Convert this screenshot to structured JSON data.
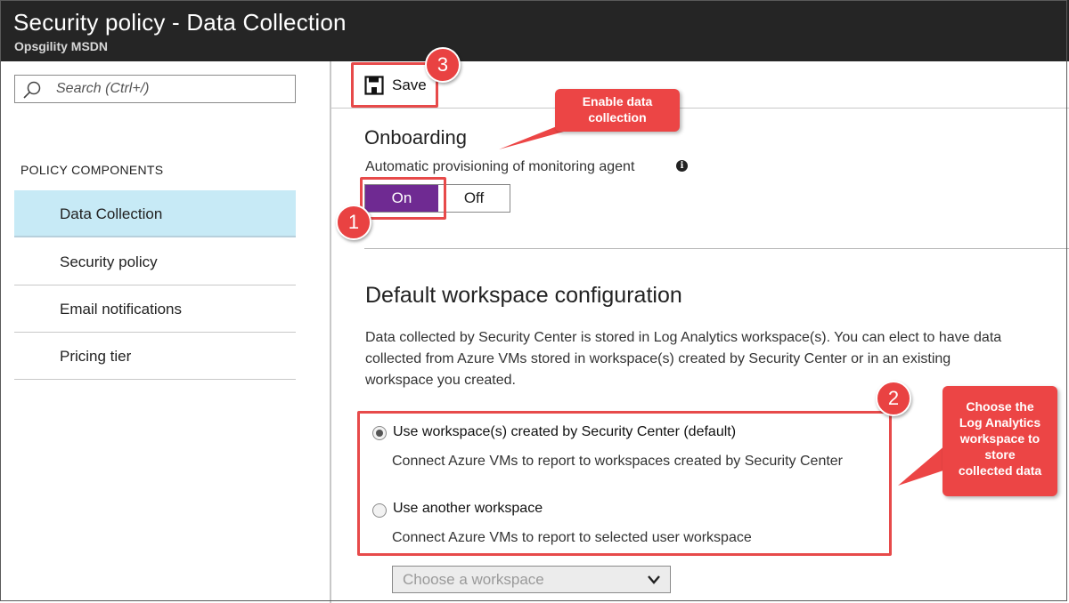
{
  "header": {
    "title": "Security policy - Data Collection",
    "subtitle": "Opsgility MSDN"
  },
  "sidebar": {
    "search_placeholder": "Search (Ctrl+/)",
    "section_header": "POLICY COMPONENTS",
    "items": [
      {
        "label": "Data Collection",
        "active": true
      },
      {
        "label": "Security policy",
        "active": false
      },
      {
        "label": "Email notifications",
        "active": false
      },
      {
        "label": "Pricing tier",
        "active": false
      }
    ]
  },
  "toolbar": {
    "save_label": "Save",
    "save_icon": "floppy-disk-icon"
  },
  "onboarding": {
    "heading": "Onboarding",
    "provisioning_label": "Automatic provisioning of monitoring agent",
    "info_icon": "info-icon",
    "toggle_on": "On",
    "toggle_off": "Off",
    "selected": "On"
  },
  "workspace": {
    "heading": "Default workspace configuration",
    "description_lines": [
      "Data collected by Security Center is stored in Log Analytics workspace(s). You can elect to have data",
      "collected from Azure VMs stored in workspace(s) created by Security Center or in an existing",
      "workspace you created."
    ],
    "options": [
      {
        "label": "Use workspace(s) created by Security Center (default)",
        "description": "Connect Azure VMs to report to workspaces created by Security Center",
        "checked": true
      },
      {
        "label": "Use another workspace",
        "description": "Connect Azure VMs to report to selected user workspace",
        "checked": false
      }
    ],
    "select_placeholder": "Choose a workspace"
  },
  "annotations": {
    "badges": [
      "1",
      "2",
      "3"
    ],
    "callout_enable": [
      "Enable data",
      "collection"
    ],
    "callout_choose": [
      "Choose the",
      "Log Analytics",
      "workspace to",
      "store",
      "collected data"
    ],
    "accent_color": "#e94242"
  },
  "colors": {
    "header_bg": "#252525",
    "active_nav_bg": "#c7eaf6",
    "toggle_on_bg": "#6f2a92"
  }
}
